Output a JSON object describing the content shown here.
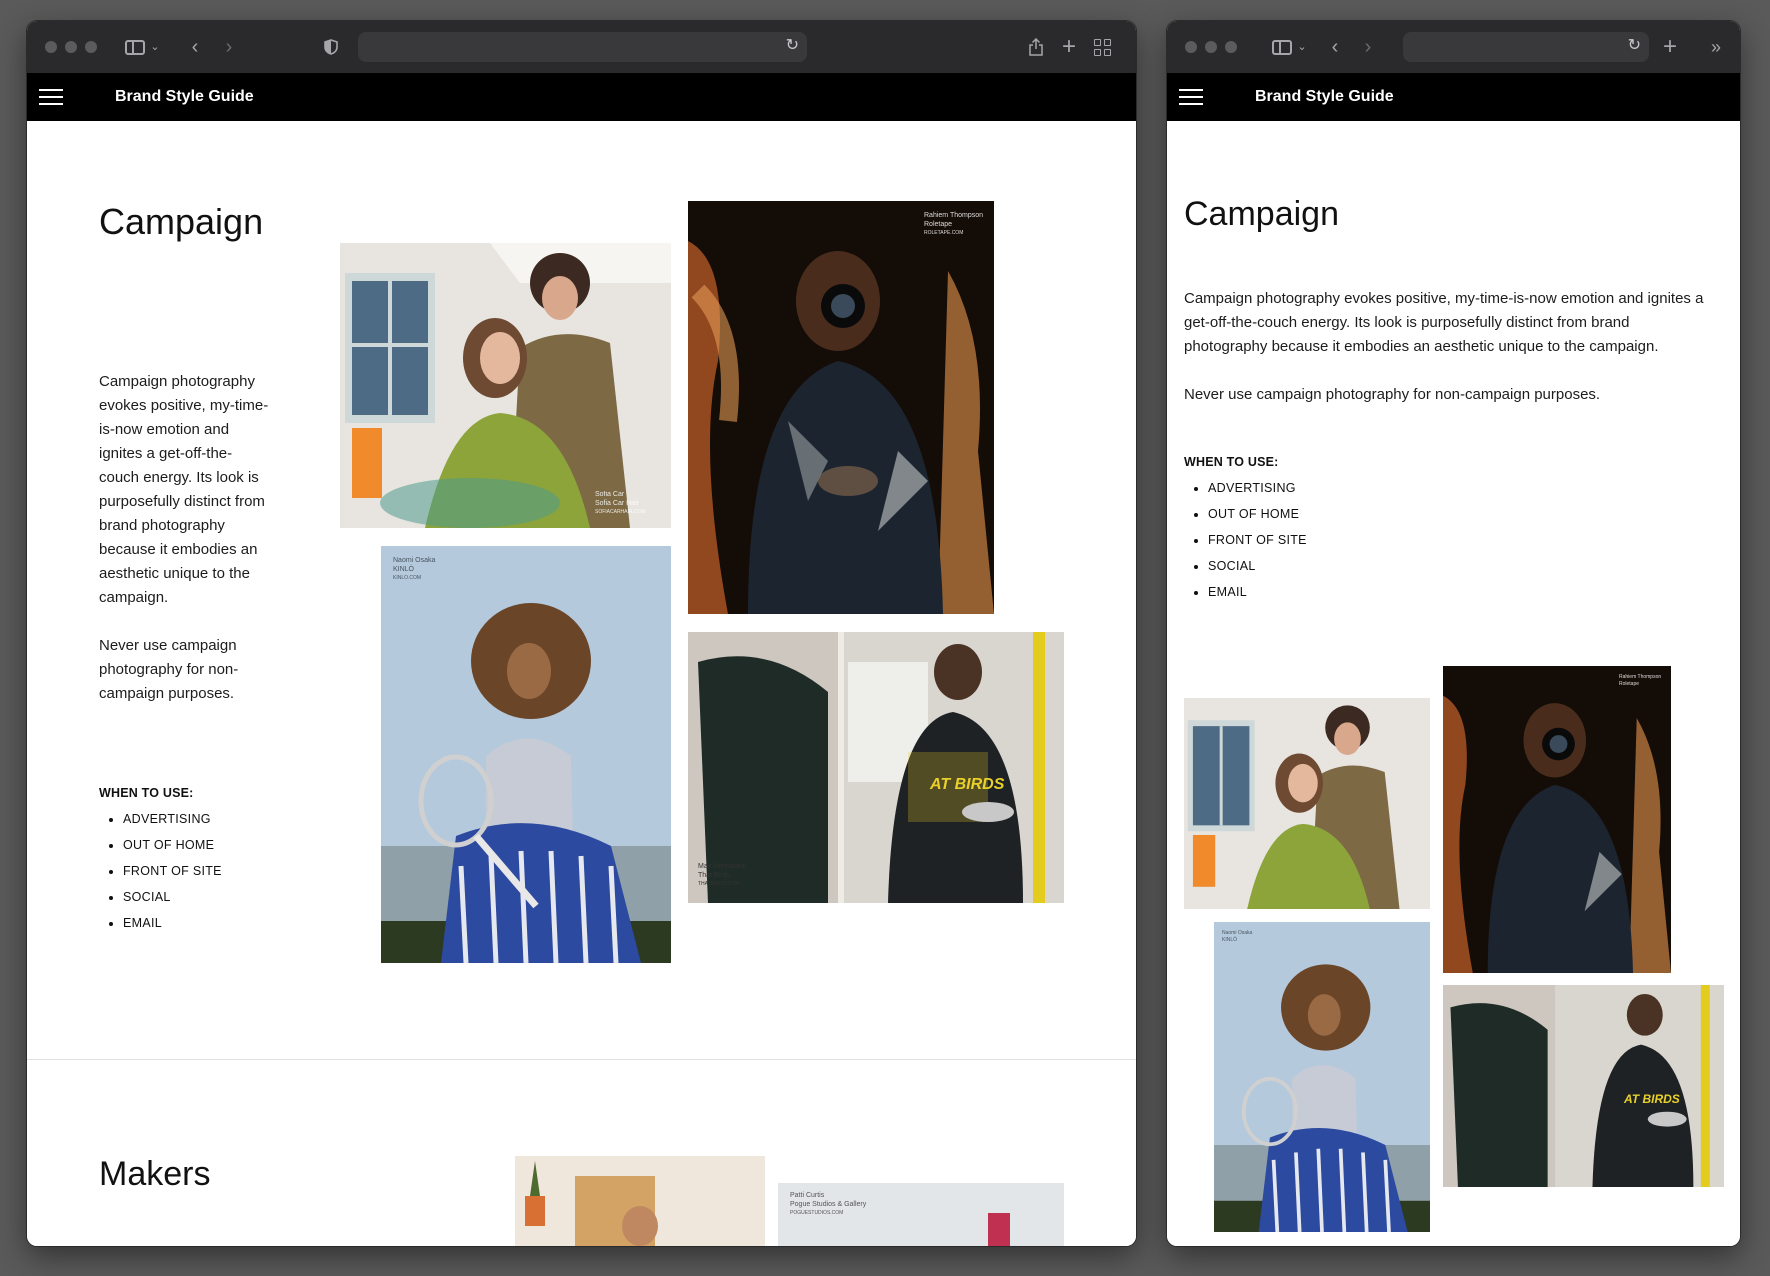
{
  "nav": {
    "title": "Brand Style Guide"
  },
  "campaign": {
    "heading": "Campaign",
    "paragraph1": "Campaign photography evokes positive, my-time-is-now emotion and ignites a get-off-the-couch energy. Its look is purposefully distinct from brand photography because it embodies an aesthetic unique to the campaign.",
    "paragraph2": "Never use campaign photography for non-campaign purposes.",
    "when_label": "WHEN TO USE:",
    "uses": [
      "ADVERTISING",
      "OUT OF HOME",
      "FRONT OF SITE",
      "SOCIAL",
      "EMAIL"
    ]
  },
  "photos": {
    "stylist": {
      "caption": [
        "Sofia Car",
        "Sofia Car Hair",
        "SOFIACARHAIR.COM"
      ]
    },
    "photographer": {
      "caption": [
        "Rahiem Thompson",
        "Roletape",
        "ROLETAPE.COM"
      ]
    },
    "tennis": {
      "caption": [
        "Naomi Osaka",
        "KINLÒ",
        "KINLO.COM"
      ]
    },
    "restaurant": {
      "caption": [
        "Max Henriquez",
        "That Birds",
        "THATBIRDS.COM"
      ],
      "shirt_text": "AT BIRDS"
    }
  },
  "makers": {
    "heading": "Makers",
    "caption": [
      "Patti Curtis",
      "Pogue Studios & Gallery",
      "POGUESTUDIOS.COM"
    ]
  }
}
